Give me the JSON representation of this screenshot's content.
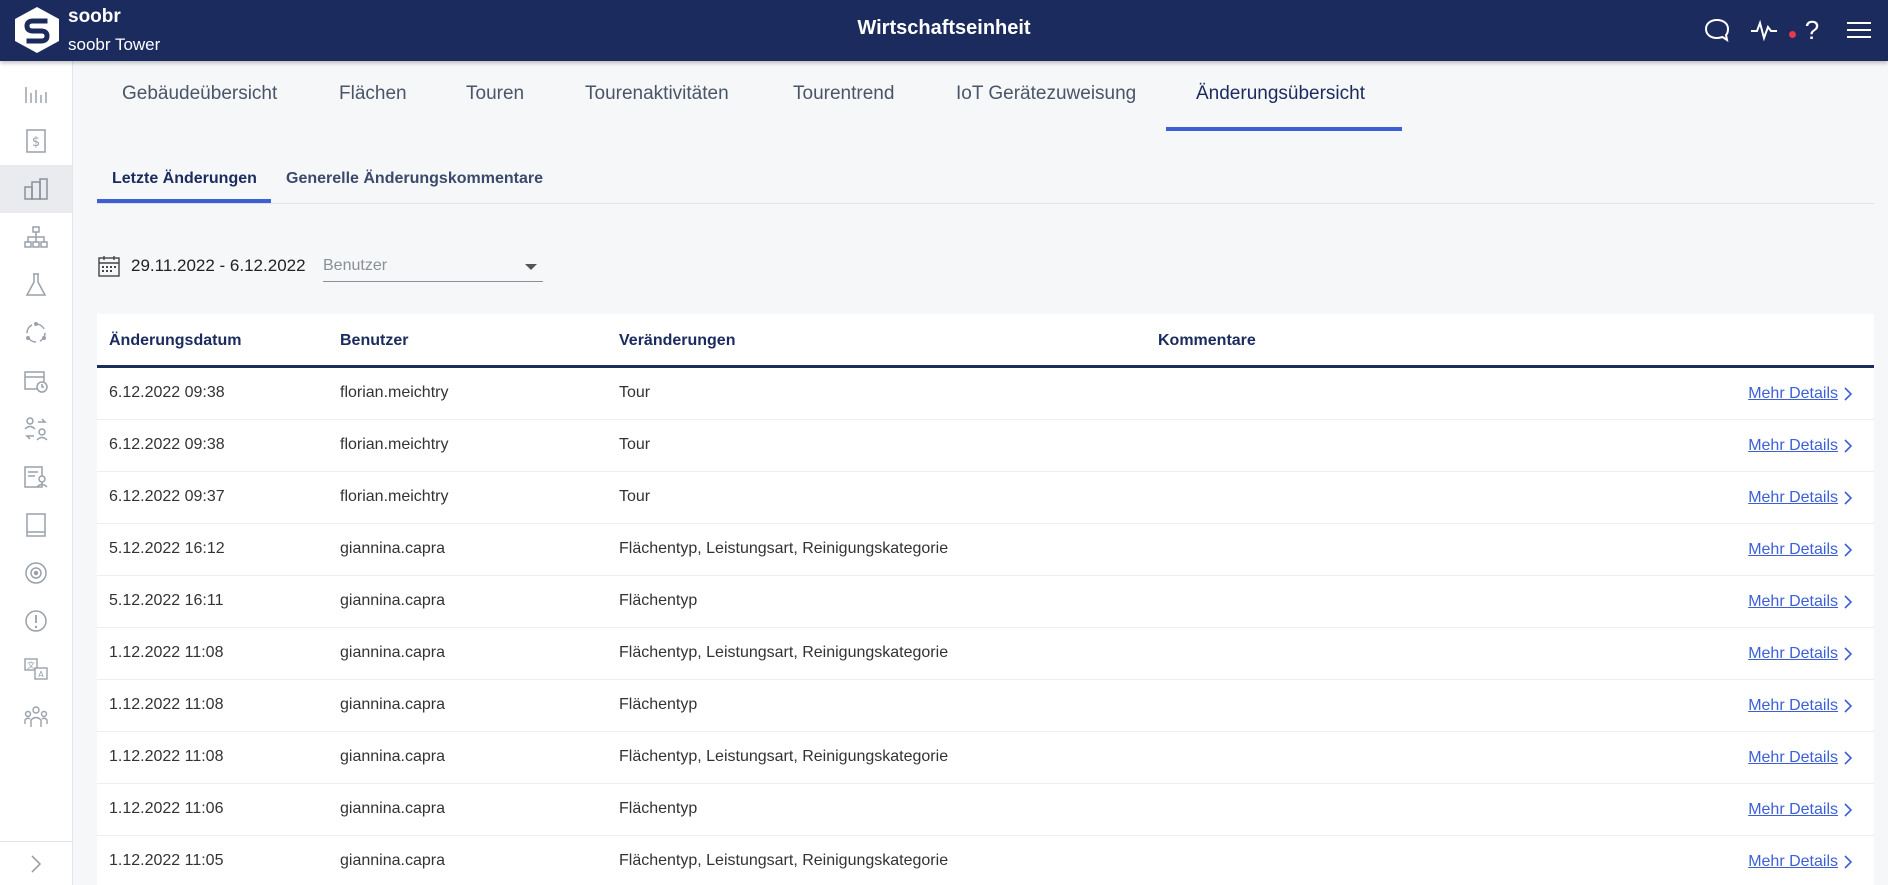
{
  "header": {
    "brand": "soobr",
    "building": "soobr Tower",
    "title": "Wirtschaftseinheit"
  },
  "main_tabs": [
    {
      "label": "Gebäudeübersicht"
    },
    {
      "label": "Flächen"
    },
    {
      "label": "Touren"
    },
    {
      "label": "Tourenaktivitäten"
    },
    {
      "label": "Tourentrend"
    },
    {
      "label": "IoT Gerätezuweisung"
    },
    {
      "label": "Änderungsübersicht"
    }
  ],
  "sub_tabs": [
    {
      "label": "Letzte Änderungen"
    },
    {
      "label": "Generelle Änderungskommentare"
    }
  ],
  "filters": {
    "date_range": "29.11.2022 - 6.12.2022",
    "user_placeholder": "Benutzer"
  },
  "table": {
    "columns": [
      "Änderungsdatum",
      "Benutzer",
      "Veränderungen",
      "Kommentare"
    ],
    "more_label": "Mehr Details",
    "rows": [
      {
        "date": "6.12.2022 09:38",
        "user": "florian.meichtry",
        "change": "Tour",
        "comment": ""
      },
      {
        "date": "6.12.2022 09:38",
        "user": "florian.meichtry",
        "change": "Tour",
        "comment": ""
      },
      {
        "date": "6.12.2022 09:37",
        "user": "florian.meichtry",
        "change": "Tour",
        "comment": ""
      },
      {
        "date": "5.12.2022 16:12",
        "user": "giannina.capra",
        "change": "Flächentyp, Leistungsart, Reinigungskategorie",
        "comment": ""
      },
      {
        "date": "5.12.2022 16:11",
        "user": "giannina.capra",
        "change": "Flächentyp",
        "comment": ""
      },
      {
        "date": "1.12.2022 11:08",
        "user": "giannina.capra",
        "change": "Flächentyp, Leistungsart, Reinigungskategorie",
        "comment": ""
      },
      {
        "date": "1.12.2022 11:08",
        "user": "giannina.capra",
        "change": "Flächentyp",
        "comment": ""
      },
      {
        "date": "1.12.2022 11:08",
        "user": "giannina.capra",
        "change": "Flächentyp, Leistungsart, Reinigungskategorie",
        "comment": ""
      },
      {
        "date": "1.12.2022 11:06",
        "user": "giannina.capra",
        "change": "Flächentyp",
        "comment": ""
      },
      {
        "date": "1.12.2022 11:05",
        "user": "giannina.capra",
        "change": "Flächentyp, Leistungsart, Reinigungskategorie",
        "comment": ""
      }
    ]
  },
  "colors": {
    "header_bg": "#1b2b5e",
    "accent": "#3d5fd6",
    "alert_dot": "#e8374f"
  }
}
